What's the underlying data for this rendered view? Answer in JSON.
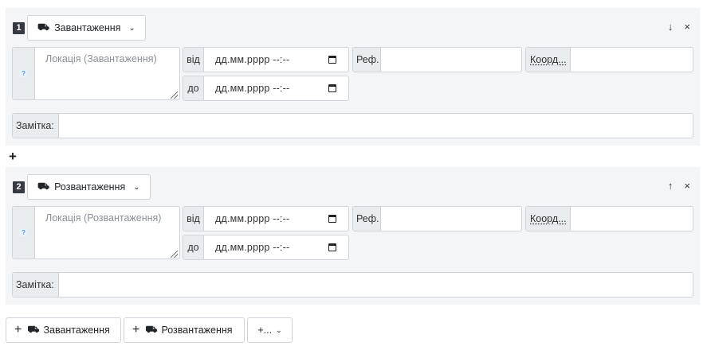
{
  "stops": [
    {
      "number": "1",
      "type_label": "Завантаження",
      "type_icon": "truck-loading-icon",
      "move_icon": "↓",
      "remove_icon": "×",
      "help_badge": "?",
      "location_placeholder": "Локація (Завантаження)",
      "from_label": "від",
      "to_label": "до",
      "date_from": "дд.мм.рррр --:--",
      "date_to": "дд.мм.рррр --:--",
      "ref_label": "Реф.",
      "ref_value": "",
      "coord_label": "Коорд...",
      "coord_value": "",
      "note_label": "Замітка:",
      "note_value": ""
    },
    {
      "number": "2",
      "type_label": "Розвантаження",
      "type_icon": "truck-unloading-icon",
      "move_icon": "↑",
      "remove_icon": "×",
      "help_badge": "?",
      "location_placeholder": "Локація (Розвантаження)",
      "from_label": "від",
      "to_label": "до",
      "date_from": "дд.мм.рррр --:--",
      "date_to": "дд.мм.рррр --:--",
      "ref_label": "Реф.",
      "ref_value": "",
      "coord_label": "Коорд...",
      "coord_value": "",
      "note_label": "Замітка:",
      "note_value": ""
    }
  ],
  "add_between_label": "+",
  "bottom": {
    "add_loading": "Завантаження",
    "add_unloading": "Розвантаження",
    "more_label": "+...",
    "plus": "+"
  }
}
